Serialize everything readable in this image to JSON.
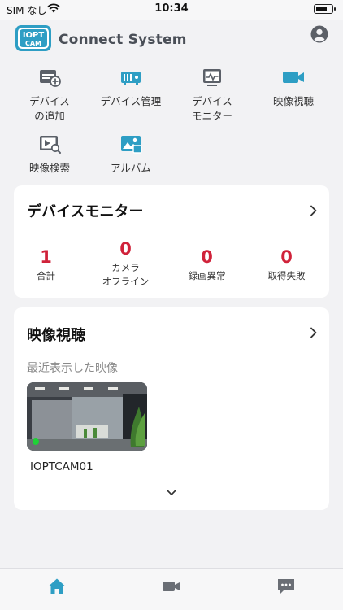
{
  "status": {
    "carrier": "SIM なし",
    "time": "10:34",
    "battery_level": 0.7
  },
  "header": {
    "logo_text_top": "IOPT",
    "logo_text_bottom": "CAM",
    "title": "Connect System"
  },
  "menu": [
    {
      "label": "デバイス\nの追加",
      "icon": "add-device-icon"
    },
    {
      "label": "デバイス管理",
      "icon": "device-management-icon"
    },
    {
      "label": "デバイス\nモニター",
      "icon": "device-monitor-icon"
    },
    {
      "label": "映像視聴",
      "icon": "video-camera-icon"
    },
    {
      "label": "映像検索",
      "icon": "video-search-icon"
    },
    {
      "label": "アルバム",
      "icon": "album-icon"
    }
  ],
  "monitor_card": {
    "title": "デバイスモニター",
    "stats": [
      {
        "value": "1",
        "label": "合計"
      },
      {
        "value": "0",
        "label": "カメラ\nオフライン"
      },
      {
        "value": "0",
        "label": "録画異常"
      },
      {
        "value": "0",
        "label": "取得失敗"
      }
    ]
  },
  "video_card": {
    "title": "映像視聴",
    "recent_label": "最近表示した映像",
    "camera_name": "IOPTCAM01"
  },
  "tabs": [
    "home-icon",
    "video-camera-icon",
    "message-icon"
  ],
  "colors": {
    "accent": "#2e9ec4",
    "stat_red": "#d0223a",
    "live_dot": "#1fd136"
  }
}
